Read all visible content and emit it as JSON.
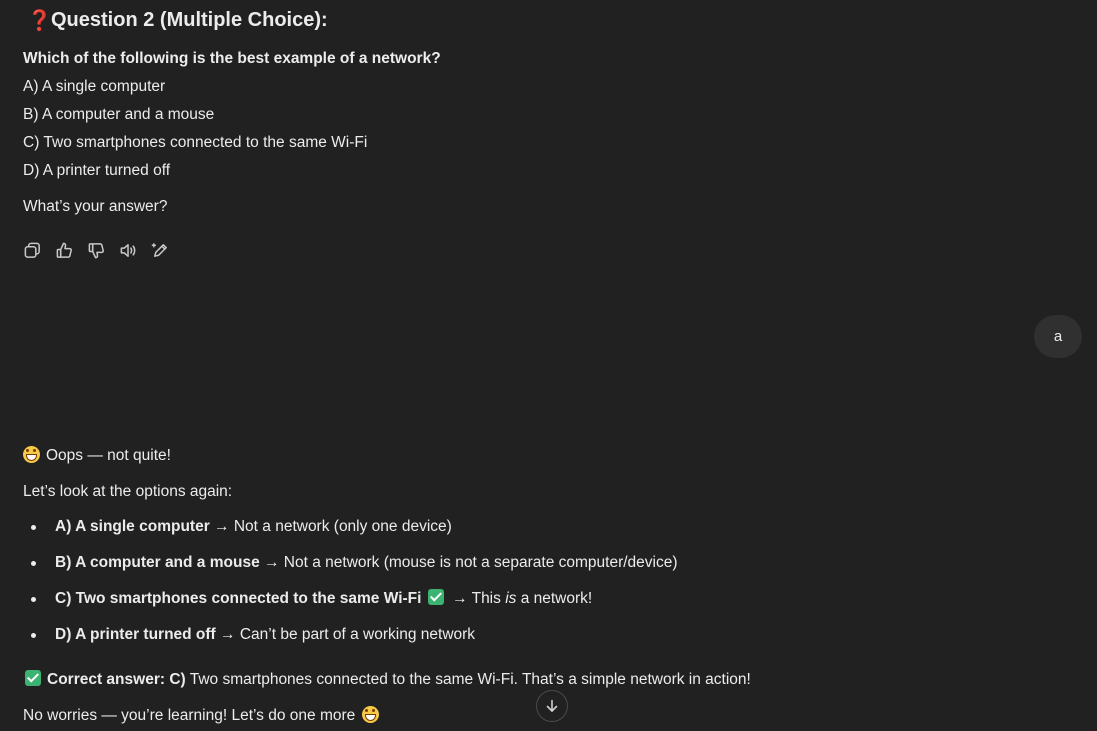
{
  "question": {
    "title": "Question 2 (Multiple Choice):",
    "prompt": "Which of the following is the best example of a network?",
    "options": [
      "A) A single computer",
      "B) A computer and a mouse",
      "C) Two smartphones connected to the same Wi-Fi",
      "D) A printer turned off"
    ],
    "ask": "What’s your answer?"
  },
  "actions": [
    "copy-icon",
    "thumbs-up-icon",
    "thumbs-down-icon",
    "read-aloud-icon",
    "edit-icon"
  ],
  "user_message": "a",
  "feedback": {
    "intro": "Oops — not quite!",
    "lead": "Let’s look at the options again:",
    "items": [
      {
        "bold": "A) A single computer",
        "rest": " → Not a network (only one device)"
      },
      {
        "bold": "B) A computer and a mouse",
        "rest": " → Not a network (mouse is not a separate computer/device)"
      },
      {
        "bold": "C) Two smartphones connected to the same Wi-Fi",
        "rest_before": " → This ",
        "emph": "is",
        "rest_after": " a network!"
      },
      {
        "bold": "D) A printer turned off",
        "rest": " → Can’t be part of a working network"
      }
    ],
    "correct_label": "Correct answer:",
    "correct_choice": "C)",
    "correct_text": " Two smartphones connected to the same Wi-Fi. That’s a simple network in action!",
    "closing": "No worries — you’re learning! Let’s do one more"
  },
  "colors": {
    "background": "#212121",
    "text": "#ececec",
    "question_mark": "#e0245e",
    "check": "#3cb371",
    "user_bubble": "#303030"
  }
}
